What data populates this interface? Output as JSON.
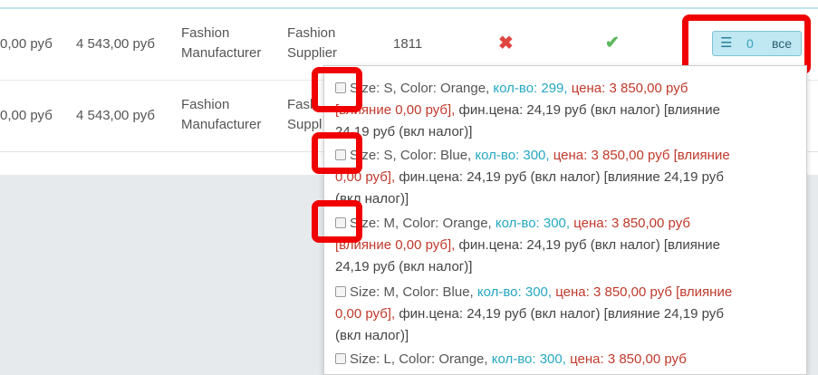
{
  "rows": [
    {
      "price1": "0,00 руб",
      "price2": "4 543,00 руб",
      "manufacturer": "Fashion Manufacturer",
      "manufacturer_l1": "Fashion",
      "manufacturer_l2": "Manufacturer",
      "supplier_l1": "Fashion",
      "supplier_l2": "Supplier",
      "quantity": "1811",
      "status_icon": "x-icon",
      "active_icon": "check-icon"
    },
    {
      "price1": "0,00 руб",
      "price2": "4 543,00 руб",
      "manufacturer_l1": "Fashion",
      "manufacturer_l2": "Manufacturer",
      "supplier_l1": "Fash",
      "supplier_l2": "Suppl"
    }
  ],
  "combinations_button": {
    "icon": "list-icon",
    "count": "0",
    "label": "все"
  },
  "combinations": [
    {
      "name": "Size: S, Color: Orange,",
      "qty": "кол-во: 299,",
      "price": "цена: 3 850,00 руб",
      "impact": "[влияние 0,00 руб],",
      "final_l1": "фин.цена: 24,19 руб (вкл налог) [влияние",
      "final_l2": "24,19 руб (вкл налог)]"
    },
    {
      "name": "Size: S, Color: Blue,",
      "qty": "кол-во: 300,",
      "price": "цена: 3 850,00 руб [влияние",
      "impact": "0,00 руб],",
      "final_l1": "фин.цена: 24,19 руб (вкл налог) [влияние 24,19 руб",
      "final_l2": "(вкл налог)]"
    },
    {
      "name": "Size: M, Color: Orange,",
      "qty": "кол-во: 300,",
      "price": "цена: 3 850,00 руб",
      "impact": "[влияние 0,00 руб],",
      "final_l1": "фин.цена: 24,19 руб (вкл налог) [влияние",
      "final_l2": "24,19 руб (вкл налог)]"
    },
    {
      "name": "Size: M, Color: Blue,",
      "qty": "кол-во: 300,",
      "price": "цена: 3 850,00 руб [влияние",
      "impact": "0,00 руб],",
      "final_l1": "фин.цена: 24,19 руб (вкл налог) [влияние 24,19 руб",
      "final_l2": "(вкл налог)]"
    },
    {
      "name": "Size: L, Color: Orange,",
      "qty": "кол-во: 300,",
      "price": "цена: 3 850,00 руб"
    }
  ],
  "colors": {
    "highlight": "#f10000",
    "quantity_text": "#25a7c1",
    "price_text": "#c0392b",
    "button_bg": "#bfe8f2"
  }
}
